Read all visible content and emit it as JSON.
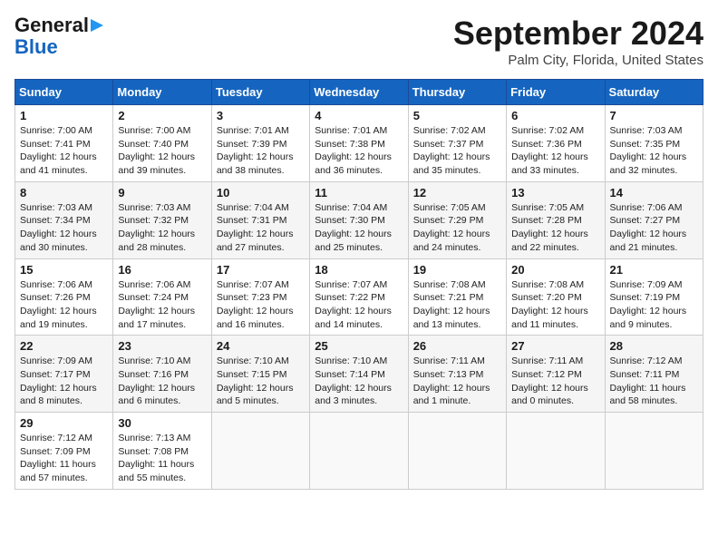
{
  "header": {
    "logo_line1": "General",
    "logo_line2": "Blue",
    "month": "September 2024",
    "location": "Palm City, Florida, United States"
  },
  "days_of_week": [
    "Sunday",
    "Monday",
    "Tuesday",
    "Wednesday",
    "Thursday",
    "Friday",
    "Saturday"
  ],
  "weeks": [
    [
      {
        "day": "1",
        "info": "Sunrise: 7:00 AM\nSunset: 7:41 PM\nDaylight: 12 hours\nand 41 minutes."
      },
      {
        "day": "2",
        "info": "Sunrise: 7:00 AM\nSunset: 7:40 PM\nDaylight: 12 hours\nand 39 minutes."
      },
      {
        "day": "3",
        "info": "Sunrise: 7:01 AM\nSunset: 7:39 PM\nDaylight: 12 hours\nand 38 minutes."
      },
      {
        "day": "4",
        "info": "Sunrise: 7:01 AM\nSunset: 7:38 PM\nDaylight: 12 hours\nand 36 minutes."
      },
      {
        "day": "5",
        "info": "Sunrise: 7:02 AM\nSunset: 7:37 PM\nDaylight: 12 hours\nand 35 minutes."
      },
      {
        "day": "6",
        "info": "Sunrise: 7:02 AM\nSunset: 7:36 PM\nDaylight: 12 hours\nand 33 minutes."
      },
      {
        "day": "7",
        "info": "Sunrise: 7:03 AM\nSunset: 7:35 PM\nDaylight: 12 hours\nand 32 minutes."
      }
    ],
    [
      {
        "day": "8",
        "info": "Sunrise: 7:03 AM\nSunset: 7:34 PM\nDaylight: 12 hours\nand 30 minutes."
      },
      {
        "day": "9",
        "info": "Sunrise: 7:03 AM\nSunset: 7:32 PM\nDaylight: 12 hours\nand 28 minutes."
      },
      {
        "day": "10",
        "info": "Sunrise: 7:04 AM\nSunset: 7:31 PM\nDaylight: 12 hours\nand 27 minutes."
      },
      {
        "day": "11",
        "info": "Sunrise: 7:04 AM\nSunset: 7:30 PM\nDaylight: 12 hours\nand 25 minutes."
      },
      {
        "day": "12",
        "info": "Sunrise: 7:05 AM\nSunset: 7:29 PM\nDaylight: 12 hours\nand 24 minutes."
      },
      {
        "day": "13",
        "info": "Sunrise: 7:05 AM\nSunset: 7:28 PM\nDaylight: 12 hours\nand 22 minutes."
      },
      {
        "day": "14",
        "info": "Sunrise: 7:06 AM\nSunset: 7:27 PM\nDaylight: 12 hours\nand 21 minutes."
      }
    ],
    [
      {
        "day": "15",
        "info": "Sunrise: 7:06 AM\nSunset: 7:26 PM\nDaylight: 12 hours\nand 19 minutes."
      },
      {
        "day": "16",
        "info": "Sunrise: 7:06 AM\nSunset: 7:24 PM\nDaylight: 12 hours\nand 17 minutes."
      },
      {
        "day": "17",
        "info": "Sunrise: 7:07 AM\nSunset: 7:23 PM\nDaylight: 12 hours\nand 16 minutes."
      },
      {
        "day": "18",
        "info": "Sunrise: 7:07 AM\nSunset: 7:22 PM\nDaylight: 12 hours\nand 14 minutes."
      },
      {
        "day": "19",
        "info": "Sunrise: 7:08 AM\nSunset: 7:21 PM\nDaylight: 12 hours\nand 13 minutes."
      },
      {
        "day": "20",
        "info": "Sunrise: 7:08 AM\nSunset: 7:20 PM\nDaylight: 12 hours\nand 11 minutes."
      },
      {
        "day": "21",
        "info": "Sunrise: 7:09 AM\nSunset: 7:19 PM\nDaylight: 12 hours\nand 9 minutes."
      }
    ],
    [
      {
        "day": "22",
        "info": "Sunrise: 7:09 AM\nSunset: 7:17 PM\nDaylight: 12 hours\nand 8 minutes."
      },
      {
        "day": "23",
        "info": "Sunrise: 7:10 AM\nSunset: 7:16 PM\nDaylight: 12 hours\nand 6 minutes."
      },
      {
        "day": "24",
        "info": "Sunrise: 7:10 AM\nSunset: 7:15 PM\nDaylight: 12 hours\nand 5 minutes."
      },
      {
        "day": "25",
        "info": "Sunrise: 7:10 AM\nSunset: 7:14 PM\nDaylight: 12 hours\nand 3 minutes."
      },
      {
        "day": "26",
        "info": "Sunrise: 7:11 AM\nSunset: 7:13 PM\nDaylight: 12 hours\nand 1 minute."
      },
      {
        "day": "27",
        "info": "Sunrise: 7:11 AM\nSunset: 7:12 PM\nDaylight: 12 hours\nand 0 minutes."
      },
      {
        "day": "28",
        "info": "Sunrise: 7:12 AM\nSunset: 7:11 PM\nDaylight: 11 hours\nand 58 minutes."
      }
    ],
    [
      {
        "day": "29",
        "info": "Sunrise: 7:12 AM\nSunset: 7:09 PM\nDaylight: 11 hours\nand 57 minutes."
      },
      {
        "day": "30",
        "info": "Sunrise: 7:13 AM\nSunset: 7:08 PM\nDaylight: 11 hours\nand 55 minutes."
      },
      {
        "day": "",
        "info": ""
      },
      {
        "day": "",
        "info": ""
      },
      {
        "day": "",
        "info": ""
      },
      {
        "day": "",
        "info": ""
      },
      {
        "day": "",
        "info": ""
      }
    ]
  ]
}
